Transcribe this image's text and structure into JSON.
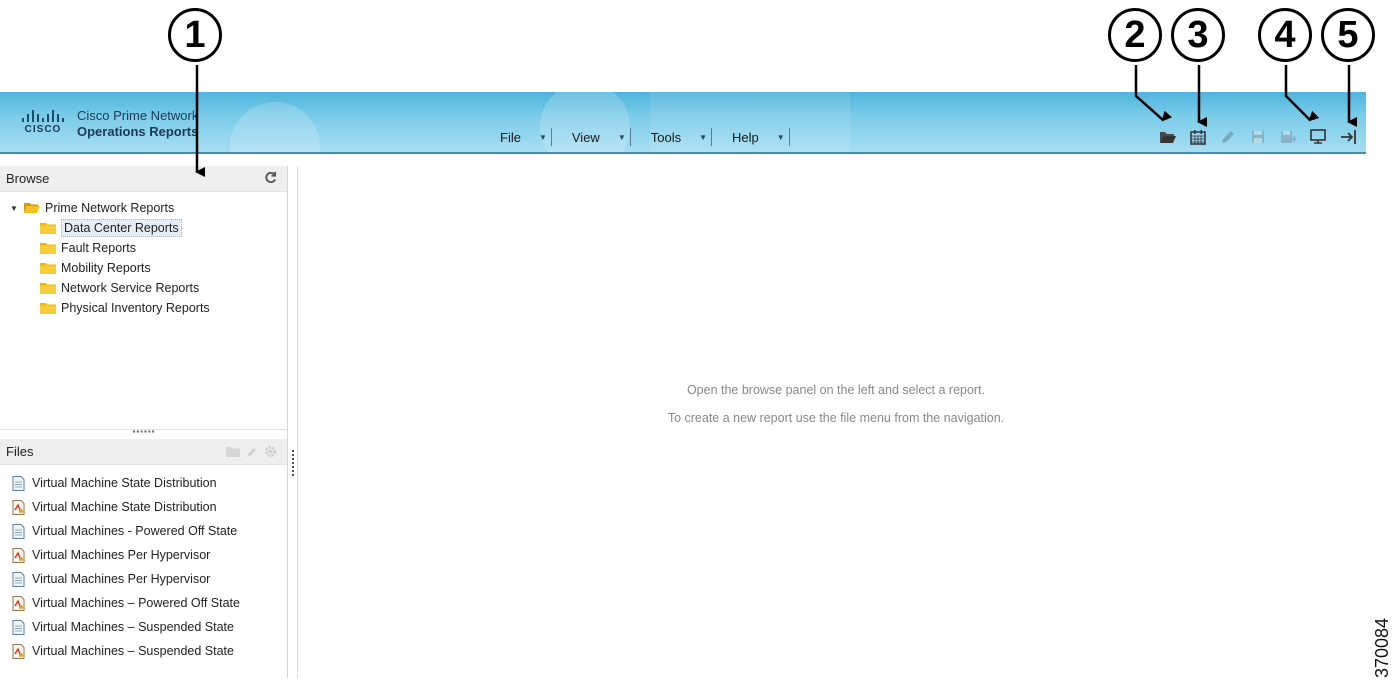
{
  "callouts": [
    "1",
    "2",
    "3",
    "4",
    "5"
  ],
  "header": {
    "brand": "CISCO",
    "product_line1": "Cisco Prime Network",
    "product_line2": "Operations Reports",
    "menus": [
      {
        "label": "File"
      },
      {
        "label": "View"
      },
      {
        "label": "Tools"
      },
      {
        "label": "Help"
      }
    ],
    "toolbar_icons": [
      "open-folder-icon",
      "schedule-icon",
      "edit-icon",
      "save-icon",
      "save-as-icon",
      "screen-icon",
      "logout-icon"
    ]
  },
  "browse": {
    "title": "Browse",
    "root": "Prime Network Reports",
    "children": [
      "Data Center Reports",
      "Fault Reports",
      "Mobility Reports",
      "Network Service Reports",
      "Physical Inventory Reports"
    ],
    "selected_index": 0
  },
  "files": {
    "title": "Files",
    "items": [
      {
        "name": "Virtual Machine State Distribution",
        "type": "doc"
      },
      {
        "name": "Virtual Machine State Distribution",
        "type": "report"
      },
      {
        "name": "Virtual Machines - Powered Off State",
        "type": "doc"
      },
      {
        "name": "Virtual Machines Per Hypervisor",
        "type": "report"
      },
      {
        "name": "Virtual Machines Per Hypervisor",
        "type": "doc"
      },
      {
        "name": "Virtual Machines – Powered Off State",
        "type": "report"
      },
      {
        "name": "Virtual Machines – Suspended State",
        "type": "doc"
      },
      {
        "name": "Virtual Machines – Suspended State",
        "type": "report"
      }
    ]
  },
  "empty_state": {
    "line1": "Open the browse panel on the left and select a report.",
    "line2": "To create a new report use the file menu from the navigation."
  },
  "figure_number": "370084",
  "colors": {
    "header": "#7bcbe9",
    "folder": "#f2b600",
    "callout": "#000000"
  }
}
